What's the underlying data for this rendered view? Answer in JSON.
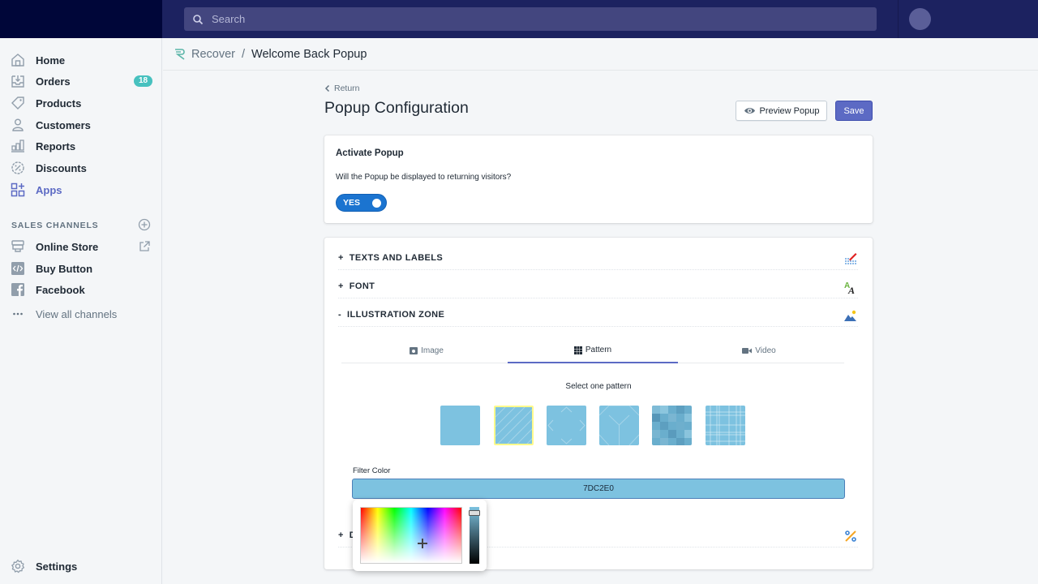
{
  "topbar": {
    "search_placeholder": "Search"
  },
  "sidebar": {
    "items": [
      {
        "label": "Home",
        "icon": "home-icon"
      },
      {
        "label": "Orders",
        "icon": "orders-icon",
        "badge": "18"
      },
      {
        "label": "Products",
        "icon": "tag-icon"
      },
      {
        "label": "Customers",
        "icon": "customer-icon"
      },
      {
        "label": "Reports",
        "icon": "reports-icon"
      },
      {
        "label": "Discounts",
        "icon": "discount-icon"
      },
      {
        "label": "Apps",
        "icon": "apps-icon",
        "active": true
      }
    ],
    "sales_channels_title": "SALES CHANNELS",
    "channels": [
      {
        "label": "Online Store",
        "icon": "store-icon"
      },
      {
        "label": "Buy Button",
        "icon": "code-icon"
      },
      {
        "label": "Facebook",
        "icon": "facebook-icon"
      }
    ],
    "view_all": "View all channels",
    "settings": "Settings"
  },
  "breadcrumb": {
    "app": "Recover",
    "separator": "/",
    "page": "Welcome Back Popup"
  },
  "page": {
    "return_label": "Return",
    "title": "Popup Configuration",
    "preview_label": "Preview Popup",
    "save_label": "Save"
  },
  "activate": {
    "title": "Activate Popup",
    "description": "Will the Popup be displayed to returning visitors?",
    "toggle_label": "YES",
    "toggle_on": true
  },
  "accordion": {
    "sections": [
      {
        "prefix": "+",
        "label": "TEXTS AND LABELS"
      },
      {
        "prefix": "+",
        "label": "FONT"
      },
      {
        "prefix": "-",
        "label": "ILLUSTRATION ZONE"
      },
      {
        "prefix": "+",
        "label": "D"
      }
    ]
  },
  "illustration": {
    "tabs": [
      {
        "label": "Image",
        "icon": "image-icon"
      },
      {
        "label": "Pattern",
        "icon": "grid-icon",
        "active": true
      },
      {
        "label": "Video",
        "icon": "video-icon"
      }
    ],
    "select_label": "Select one pattern",
    "patterns": [
      "plain",
      "diagonal-lines",
      "diamond-chevrons",
      "hexagon-cubes",
      "pixel-squares",
      "plaid"
    ],
    "selected_pattern": 1,
    "filter_label": "Filter Color",
    "filter_value": "7DC2E0"
  },
  "colors": {
    "accent": "#5c6ac4",
    "toggle": "#1b74d0",
    "filter": "#7dc2e0",
    "badge": "#47c1bf",
    "topbar": "#1c2260"
  }
}
